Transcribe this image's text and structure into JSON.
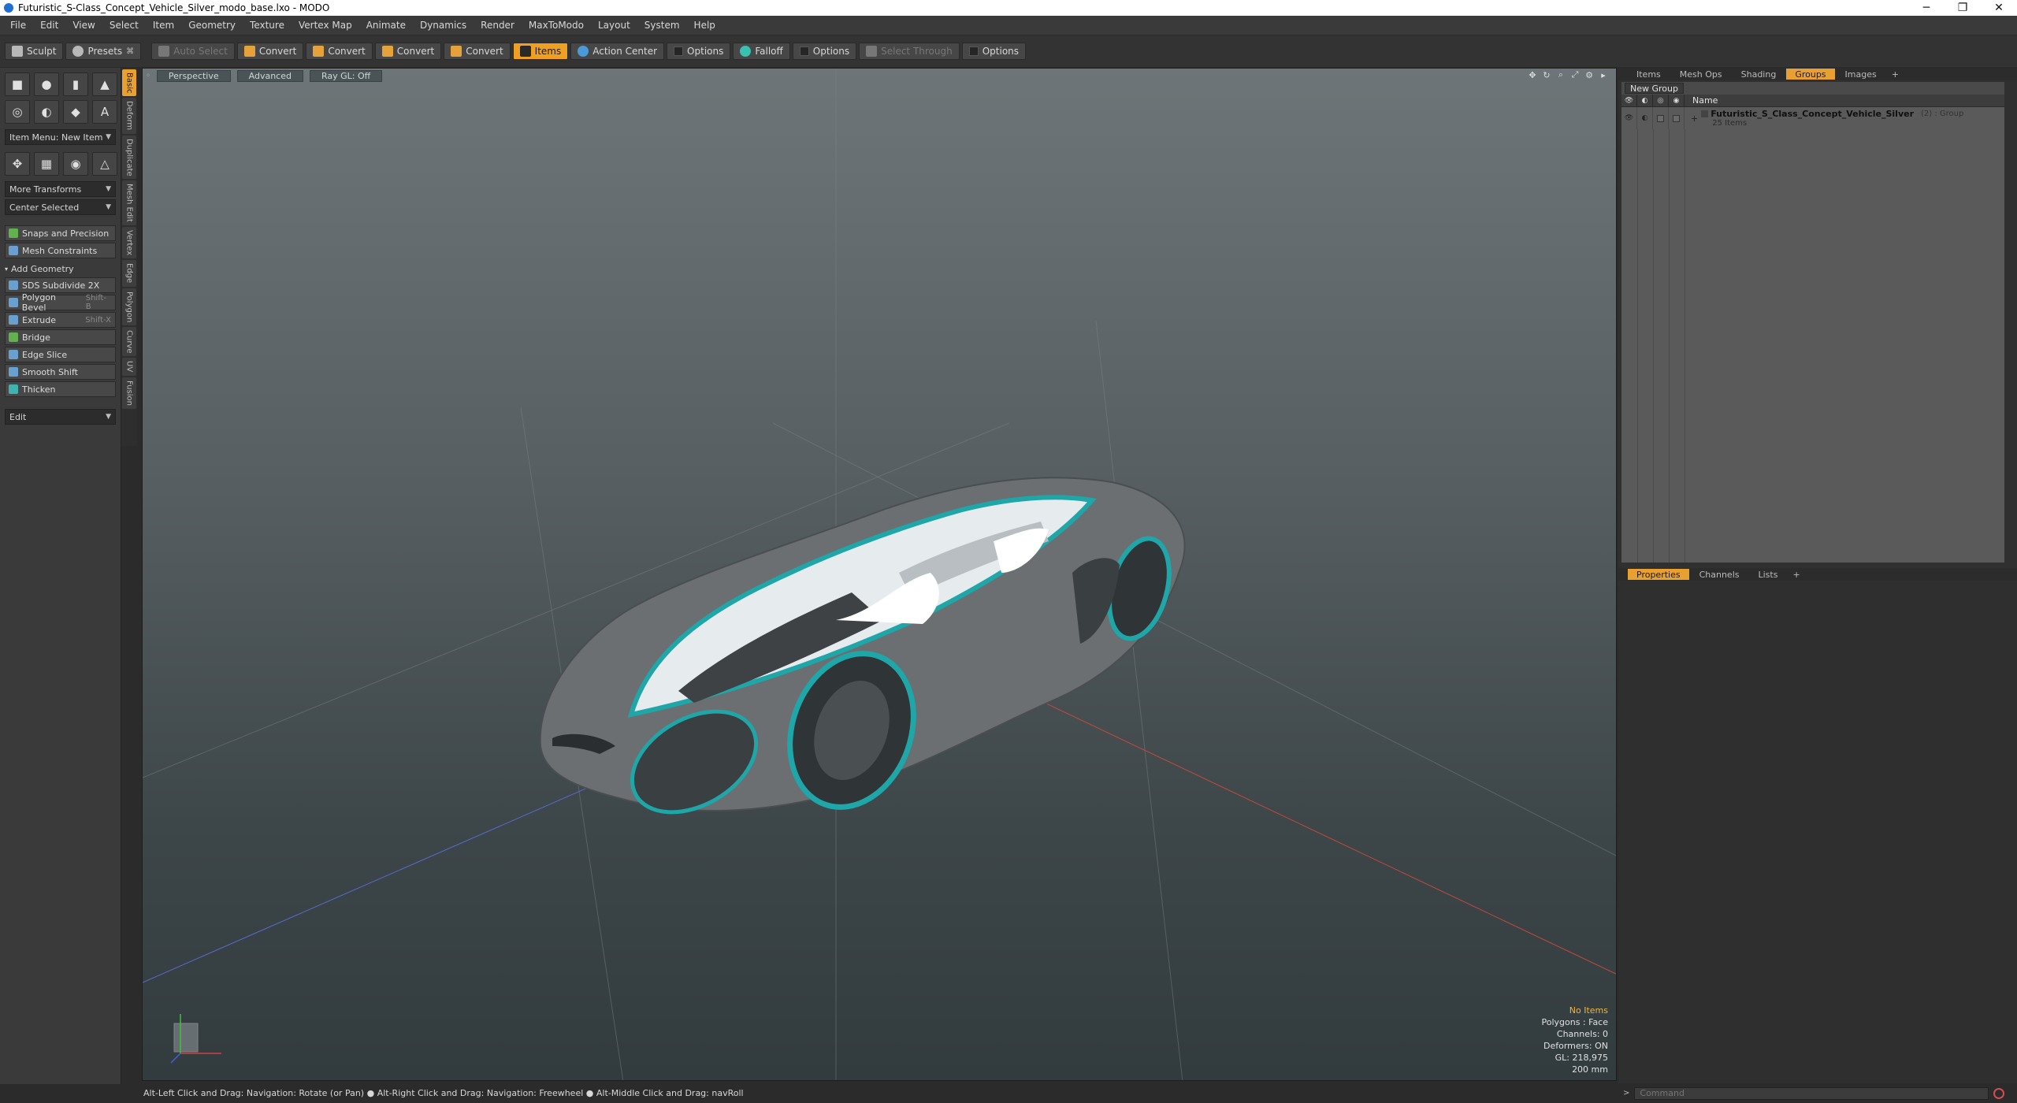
{
  "window": {
    "title": "Futuristic_S-Class_Concept_Vehicle_Silver_modo_base.lxo - MODO",
    "controls": [
      "─",
      "❐",
      "✕"
    ]
  },
  "menubar": [
    "File",
    "Edit",
    "View",
    "Select",
    "Item",
    "Geometry",
    "Texture",
    "Vertex Map",
    "Animate",
    "Dynamics",
    "Render",
    "MaxToModo",
    "Layout",
    "System",
    "Help"
  ],
  "toolbar": {
    "sculpt": "Sculpt",
    "presets": "Presets",
    "auto_select": "Auto Select",
    "convert_1": "Convert",
    "convert_2": "Convert",
    "convert_3": "Convert",
    "convert_4": "Convert",
    "items": "Items",
    "action_center": "Action Center",
    "options_1": "Options",
    "falloff": "Falloff",
    "options_2": "Options",
    "select_through": "Select Through",
    "options_3": "Options"
  },
  "leftpanel": {
    "item_menu": "Item Menu: New Item",
    "more_transforms": "More Transforms",
    "center_selected": "Center Selected",
    "snaps": "Snaps and Precision",
    "mesh_constraints": "Mesh Constraints",
    "add_geometry": "Add Geometry",
    "tools": [
      {
        "label": "SDS Subdivide 2X",
        "shortcut": ""
      },
      {
        "label": "Polygon Bevel",
        "shortcut": "Shift-B"
      },
      {
        "label": "Extrude",
        "shortcut": "Shift-X"
      },
      {
        "label": "Bridge",
        "shortcut": ""
      },
      {
        "label": "Edge Slice",
        "shortcut": ""
      },
      {
        "label": "Smooth Shift",
        "shortcut": ""
      },
      {
        "label": "Thicken",
        "shortcut": ""
      }
    ],
    "edit": "Edit"
  },
  "vtabs": [
    "Basic",
    "Deform",
    "Duplicate",
    "Mesh Edit",
    "Vertex",
    "Edge",
    "Polygon",
    "Curve",
    "UV",
    "Fusion"
  ],
  "viewport": {
    "tabs": [
      "Perspective",
      "Advanced",
      "Ray GL: Off"
    ],
    "stats": {
      "no_items": "No Items",
      "polygons": "Polygons : Face",
      "channels": "Channels: 0",
      "deformers": "Deformers: ON",
      "gl": "GL: 218,975",
      "scale": "200 mm"
    }
  },
  "rightpanel": {
    "tabs": [
      "Items",
      "Mesh Ops",
      "Shading",
      "Groups",
      "Images",
      "+"
    ],
    "new_group": "New Group",
    "name_header": "Name",
    "group": {
      "name": "Futuristic_S_Class_Concept_Vehicle_Silver",
      "meta": "(2) : Group",
      "sub": "25 Items"
    },
    "lower_tabs": [
      "Properties",
      "Channels",
      "Lists",
      "+"
    ]
  },
  "statusbar": {
    "hint": "Alt-Left Click and Drag: Navigation: Rotate (or Pan) ● Alt-Right Click and Drag: Navigation: Freewheel ● Alt-Middle Click and Drag: navRoll"
  },
  "command": {
    "placeholder": "Command"
  },
  "colors": {
    "accent": "#e8a030",
    "car_body": "#6a6e70",
    "car_trim": "#1fa6a8"
  }
}
